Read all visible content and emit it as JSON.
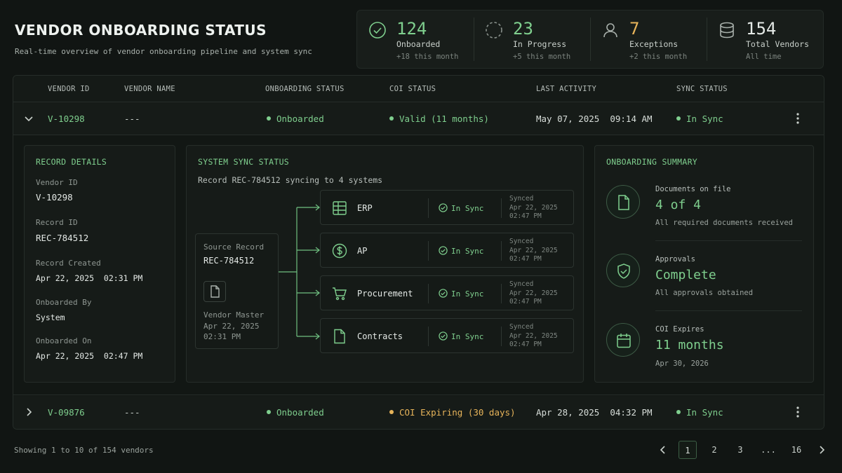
{
  "header": {
    "title": "VENDOR ONBOARDING STATUS",
    "subtitle": "Real-time overview of vendor onboarding pipeline and system sync"
  },
  "stats": [
    {
      "icon": "check-circle-icon",
      "value": "124",
      "label": "Onboarded",
      "sub": "+18 this month",
      "color": "#7fcf8e"
    },
    {
      "icon": "dashed-circle-icon",
      "value": "23",
      "label": "In Progress",
      "sub": "+5 this month",
      "color": "#7fcf8e"
    },
    {
      "icon": "user-icon",
      "value": "7",
      "label": "Exceptions",
      "sub": "+2 this month",
      "color": "#e7b45a"
    },
    {
      "icon": "database-icon",
      "value": "154",
      "label": "Total Vendors",
      "sub": "All time",
      "color": "#e4e9e6"
    }
  ],
  "table": {
    "columns": [
      "VENDOR ID",
      "VENDOR NAME",
      "ONBOARDING STATUS",
      "COI STATUS",
      "LAST ACTIVITY",
      "SYNC STATUS"
    ],
    "rows": [
      {
        "vendor_id": "V-10298",
        "vendor_name": "---",
        "onboarding": "Onboarded",
        "coi": "Valid (11 months)",
        "coi_color": "#7fcf8e",
        "last_activity": "May 07, 2025  09:14 AM",
        "sync": "In Sync",
        "expanded": true
      },
      {
        "vendor_id": "V-09876",
        "vendor_name": "---",
        "onboarding": "Onboarded",
        "coi": "COI Expiring (30 days)",
        "coi_color": "#e7b45a",
        "last_activity": "Apr 28, 2025  04:32 PM",
        "sync": "In Sync",
        "expanded": false
      }
    ]
  },
  "record_details": {
    "title": "RECORD DETAILS",
    "fields": [
      {
        "label": "Vendor ID",
        "value": "V-10298"
      },
      {
        "label": "Record ID",
        "value": "REC-784512"
      },
      {
        "label": "Record Created",
        "value": "Apr 22, 2025  02:31 PM"
      },
      {
        "label": "Onboarded By",
        "value": "System"
      },
      {
        "label": "Onboarded On",
        "value": "Apr 22, 2025  02:47 PM"
      }
    ]
  },
  "sync_status": {
    "title": "SYSTEM SYNC STATUS",
    "description": "Record REC-784512 syncing to 4 systems",
    "source": {
      "label": "Source Record",
      "id": "REC-784512",
      "name": "Vendor Master",
      "date": "Apr 22, 2025",
      "time": "02:31 PM"
    },
    "systems": [
      {
        "name": "ERP",
        "icon": "table-icon",
        "status": "In Sync",
        "synced_label": "Synced",
        "synced_date": "Apr 22, 2025",
        "synced_time": "02:47 PM"
      },
      {
        "name": "AP",
        "icon": "dollar-icon",
        "status": "In Sync",
        "synced_label": "Synced",
        "synced_date": "Apr 22, 2025",
        "synced_time": "02:47 PM"
      },
      {
        "name": "Procurement",
        "icon": "cart-icon",
        "status": "In Sync",
        "synced_label": "Synced",
        "synced_date": "Apr 22, 2025",
        "synced_time": "02:47 PM"
      },
      {
        "name": "Contracts",
        "icon": "document-icon",
        "status": "In Sync",
        "synced_label": "Synced",
        "synced_date": "Apr 22, 2025",
        "synced_time": "02:47 PM"
      }
    ]
  },
  "onboarding_summary": {
    "title": "ONBOARDING SUMMARY",
    "items": [
      {
        "icon": "document-icon",
        "label": "Documents on file",
        "value": "4 of 4",
        "sub": "All required documents received"
      },
      {
        "icon": "shield-check-icon",
        "label": "Approvals",
        "value": "Complete",
        "sub": "All approvals obtained"
      },
      {
        "icon": "calendar-icon",
        "label": "COI Expires",
        "value": "11 months",
        "sub": "Apr 30, 2026"
      }
    ]
  },
  "footer": {
    "showing": "Showing 1 to 10 of 154 vendors",
    "pages": [
      "1",
      "2",
      "3",
      "...",
      "16"
    ],
    "current_page": "1"
  }
}
